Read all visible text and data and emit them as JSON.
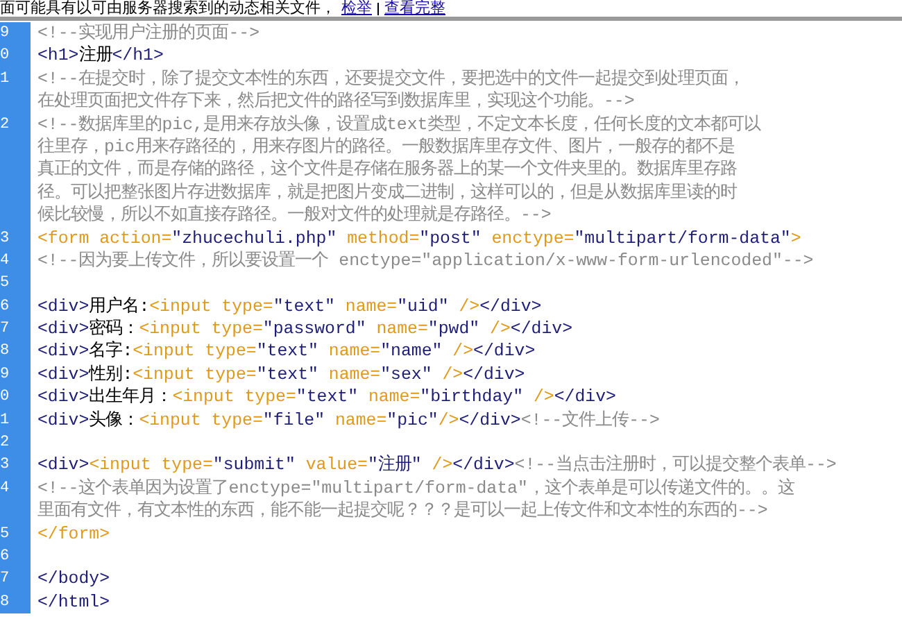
{
  "banner": {
    "text": "面可能具有以可由服务器搜索到的动态相关文件，",
    "links": [
      "检举",
      "查看完整"
    ]
  },
  "editor": {
    "lines": [
      {
        "number": "9",
        "tokens": [
          {
            "kind": "comment",
            "text": "<!--实现用户注册的页面-->"
          }
        ]
      },
      {
        "number": "0",
        "tokens": [
          {
            "kind": "tag",
            "text": "<h1>"
          },
          {
            "kind": "text",
            "text": "注册"
          },
          {
            "kind": "tag",
            "text": "</h1>"
          }
        ]
      },
      {
        "number": "1",
        "tokens": [
          {
            "kind": "comment",
            "text": "<!--在提交时，除了提交文本性的东西，还要提交文件，要把选中的文件一起提交到处理页面，"
          }
        ]
      },
      {
        "tokens": [
          {
            "kind": "comment",
            "text": "在处理页面把文件存下来，然后把文件的路径写到数据库里，实现这个功能。-->"
          }
        ]
      },
      {
        "number": "2",
        "tokens": [
          {
            "kind": "comment",
            "text": "<!--数据库里的pic,是用来存放头像，设置成text类型，不定文本长度，任何长度的文本都可以"
          }
        ]
      },
      {
        "tokens": [
          {
            "kind": "comment",
            "text": "往里存，pic用来存路径的，用来存图片的路径。一般数据库里存文件、图片，一般存的都不是"
          }
        ]
      },
      {
        "tokens": [
          {
            "kind": "comment",
            "text": "真正的文件，而是存储的路径，这个文件是存储在服务器上的某一个文件夹里的。数据库里存路"
          }
        ]
      },
      {
        "tokens": [
          {
            "kind": "comment",
            "text": "径。可以把整张图片存进数据库，就是把图片变成二进制，这样可以的，但是从数据库里读的时"
          }
        ]
      },
      {
        "tokens": [
          {
            "kind": "comment",
            "text": "候比较慢，所以不如直接存路径。一般对文件的处理就是存路径。-->"
          }
        ]
      },
      {
        "number": "3",
        "tokens": [
          {
            "kind": "attr",
            "text": "<form action="
          },
          {
            "kind": "value",
            "text": "\"zhucechuli.php\""
          },
          {
            "kind": "attr",
            "text": " method="
          },
          {
            "kind": "value",
            "text": "\"post\""
          },
          {
            "kind": "attr",
            "text": " enctype="
          },
          {
            "kind": "value",
            "text": "\"multipart/form-data\""
          },
          {
            "kind": "attr",
            "text": ">"
          }
        ]
      },
      {
        "number": "4",
        "tokens": [
          {
            "kind": "comment",
            "text": "<!--因为要上传文件，所以要设置一个 enctype=\"application/x-www-form-urlencoded\"-->"
          }
        ]
      },
      {
        "number": "5"
      },
      {
        "number": "6",
        "tokens": [
          {
            "kind": "tag",
            "text": "<div>"
          },
          {
            "kind": "text",
            "text": "用户名:"
          },
          {
            "kind": "attr",
            "text": "<input type="
          },
          {
            "kind": "value",
            "text": "\"text\""
          },
          {
            "kind": "attr",
            "text": " name="
          },
          {
            "kind": "value",
            "text": "\"uid\""
          },
          {
            "kind": "attr",
            "text": " />"
          },
          {
            "kind": "tag",
            "text": "</div>"
          }
        ]
      },
      {
        "number": "7",
        "tokens": [
          {
            "kind": "tag",
            "text": "<div>"
          },
          {
            "kind": "text",
            "text": "密码："
          },
          {
            "kind": "attr",
            "text": "<input type="
          },
          {
            "kind": "value",
            "text": "\"password\""
          },
          {
            "kind": "attr",
            "text": " name="
          },
          {
            "kind": "value",
            "text": "\"pwd\""
          },
          {
            "kind": "attr",
            "text": " />"
          },
          {
            "kind": "tag",
            "text": "</div>"
          }
        ]
      },
      {
        "number": "8",
        "tokens": [
          {
            "kind": "tag",
            "text": "<div>"
          },
          {
            "kind": "text",
            "text": "名字:"
          },
          {
            "kind": "attr",
            "text": "<input type="
          },
          {
            "kind": "value",
            "text": "\"text\""
          },
          {
            "kind": "attr",
            "text": " name="
          },
          {
            "kind": "value",
            "text": "\"name\""
          },
          {
            "kind": "attr",
            "text": " />"
          },
          {
            "kind": "tag",
            "text": "</div>"
          }
        ]
      },
      {
        "number": "9",
        "tokens": [
          {
            "kind": "tag",
            "text": "<div>"
          },
          {
            "kind": "text",
            "text": "性别:"
          },
          {
            "kind": "attr",
            "text": "<input type="
          },
          {
            "kind": "value",
            "text": "\"text\""
          },
          {
            "kind": "attr",
            "text": " name="
          },
          {
            "kind": "value",
            "text": "\"sex\""
          },
          {
            "kind": "attr",
            "text": " />"
          },
          {
            "kind": "tag",
            "text": "</div>"
          }
        ]
      },
      {
        "number": "0",
        "tokens": [
          {
            "kind": "tag",
            "text": "<div>"
          },
          {
            "kind": "text",
            "text": "出生年月："
          },
          {
            "kind": "attr",
            "text": "<input type="
          },
          {
            "kind": "value",
            "text": "\"text\""
          },
          {
            "kind": "attr",
            "text": " name="
          },
          {
            "kind": "value",
            "text": "\"birthday\""
          },
          {
            "kind": "attr",
            "text": " />"
          },
          {
            "kind": "tag",
            "text": "</div>"
          }
        ]
      },
      {
        "number": "1",
        "tokens": [
          {
            "kind": "tag",
            "text": "<div>"
          },
          {
            "kind": "text",
            "text": "头像："
          },
          {
            "kind": "attr",
            "text": "<input type="
          },
          {
            "kind": "value",
            "text": "\"file\""
          },
          {
            "kind": "attr",
            "text": " name="
          },
          {
            "kind": "value",
            "text": "\"pic\""
          },
          {
            "kind": "attr",
            "text": "/>"
          },
          {
            "kind": "tag",
            "text": "</div>"
          },
          {
            "kind": "comment",
            "text": "<!--文件上传-->"
          }
        ]
      },
      {
        "number": "2"
      },
      {
        "number": "3",
        "tokens": [
          {
            "kind": "tag",
            "text": "<div>"
          },
          {
            "kind": "attr",
            "text": "<input type="
          },
          {
            "kind": "value",
            "text": "\"submit\""
          },
          {
            "kind": "attr",
            "text": " value="
          },
          {
            "kind": "value",
            "text": "\"注册\""
          },
          {
            "kind": "attr",
            "text": " />"
          },
          {
            "kind": "tag",
            "text": "</div>"
          },
          {
            "kind": "comment",
            "text": "<!--当点击注册时，可以提交整个表单-->"
          }
        ]
      },
      {
        "number": "4",
        "tokens": [
          {
            "kind": "comment",
            "text": "<!--这个表单因为设置了enctype=\"multipart/form-data\"，这个表单是可以传递文件的。。这"
          }
        ]
      },
      {
        "tokens": [
          {
            "kind": "comment",
            "text": "里面有文件，有文本性的东西，能不能一起提交呢？？？是可以一起上传文件和文本性的东西的-->"
          }
        ]
      },
      {
        "number": "5",
        "tokens": [
          {
            "kind": "attr",
            "text": "</form>"
          }
        ]
      },
      {
        "number": "6"
      },
      {
        "number": "7",
        "tokens": [
          {
            "kind": "tag",
            "text": "</body>"
          }
        ]
      },
      {
        "number": "8",
        "tokens": [
          {
            "kind": "tag",
            "text": "</html>"
          }
        ]
      }
    ]
  }
}
